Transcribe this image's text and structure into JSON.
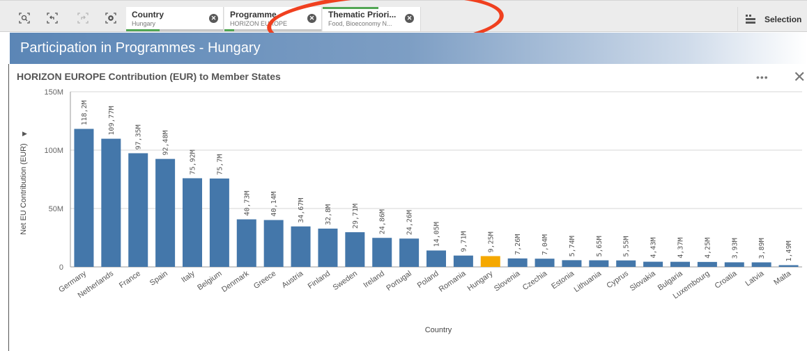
{
  "toolbar": {
    "icons": [
      "smart-search-icon",
      "step-back-icon",
      "step-forward-icon",
      "clear-selections-icon"
    ],
    "selections": [
      {
        "field": "Country",
        "value": "Hungary"
      },
      {
        "field": "Programme",
        "value": "HORIZON EUROPE"
      },
      {
        "field": "Thematic Priori...",
        "value": "Food, Bioeconomy N..."
      }
    ],
    "selections_label": "Selection"
  },
  "sheet": {
    "title": "Participation in Programmes - Hungary"
  },
  "chart_panel": {
    "more_label": "•••",
    "close_label": "✕"
  },
  "colors": {
    "bar": "#4477aa",
    "highlight": "#f5a800",
    "title_bar": "#5b86b6",
    "annotation": "#f0401f"
  },
  "chart_data": {
    "type": "bar",
    "title": "HORIZON EUROPE Contribution (EUR) to Member States",
    "xlabel": "Country",
    "ylabel": "Net EU Contribution (EUR)",
    "ylim": [
      0,
      150000000
    ],
    "yticks": [
      0,
      50000000,
      100000000,
      150000000
    ],
    "ytick_labels": [
      "0",
      "50M",
      "100M",
      "150M"
    ],
    "grid": true,
    "highlight": "Hungary",
    "categories": [
      "Germany",
      "Netherlands",
      "France",
      "Spain",
      "Italy",
      "Belgium",
      "Denmark",
      "Greece",
      "Austria",
      "Finland",
      "Sweden",
      "Ireland",
      "Portugal",
      "Poland",
      "Romania",
      "Hungary",
      "Slovenia",
      "Czechia",
      "Estonia",
      "Lithuania",
      "Cyprus",
      "Slovakia",
      "Bulgaria",
      "Luxembourg",
      "Croatia",
      "Latvia",
      "Malta"
    ],
    "values": [
      118200000,
      109770000,
      97350000,
      92480000,
      75920000,
      75700000,
      40730000,
      40140000,
      34670000,
      32800000,
      29710000,
      24860000,
      24260000,
      14050000,
      9710000,
      9250000,
      7260000,
      7040000,
      5740000,
      5650000,
      5550000,
      4430000,
      4370000,
      4250000,
      3930000,
      3890000,
      1490000
    ],
    "value_labels": [
      "118,2M",
      "109,77M",
      "97,35M",
      "92,48M",
      "75,92M",
      "75,7M",
      "40,73M",
      "40,14M",
      "34,67M",
      "32,8M",
      "29,71M",
      "24,86M",
      "24,26M",
      "14,05M",
      "9,71M",
      "9,25M",
      "7,26M",
      "7,04M",
      "5,74M",
      "5,65M",
      "5,55M",
      "4,43M",
      "4,37M",
      "4,25M",
      "3,93M",
      "3,89M",
      "1,49M"
    ]
  }
}
